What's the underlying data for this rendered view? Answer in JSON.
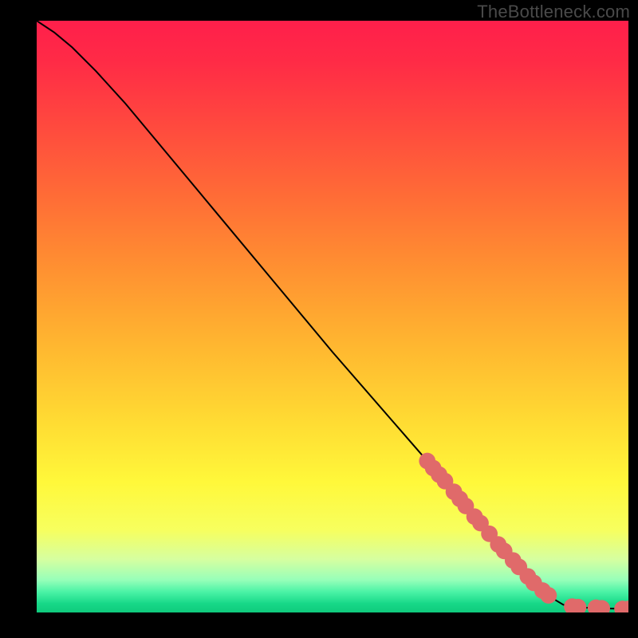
{
  "watermark": "TheBottleneck.com",
  "chart_data": {
    "type": "line",
    "title": "",
    "xlabel": "",
    "ylabel": "",
    "xlim": [
      0,
      100
    ],
    "ylim": [
      0,
      100
    ],
    "background_gradient": {
      "stops": [
        {
          "offset": 0.0,
          "color": "#ff1f4b"
        },
        {
          "offset": 0.07,
          "color": "#ff2b46"
        },
        {
          "offset": 0.18,
          "color": "#ff4a3e"
        },
        {
          "offset": 0.3,
          "color": "#ff6d36"
        },
        {
          "offset": 0.42,
          "color": "#ff9131"
        },
        {
          "offset": 0.55,
          "color": "#ffb730"
        },
        {
          "offset": 0.68,
          "color": "#ffdc33"
        },
        {
          "offset": 0.78,
          "color": "#fff83a"
        },
        {
          "offset": 0.86,
          "color": "#f7ff5e"
        },
        {
          "offset": 0.91,
          "color": "#d6ffa0"
        },
        {
          "offset": 0.945,
          "color": "#97ffb9"
        },
        {
          "offset": 0.965,
          "color": "#4bf3a6"
        },
        {
          "offset": 0.985,
          "color": "#17d888"
        },
        {
          "offset": 1.0,
          "color": "#0fca7d"
        }
      ]
    },
    "curve": {
      "comment": "line starts top-left, curved initial segment, then near-linear descent, then levels off near baseline",
      "points": [
        {
          "x": 0,
          "y": 100
        },
        {
          "x": 3,
          "y": 98
        },
        {
          "x": 6,
          "y": 95.5
        },
        {
          "x": 10,
          "y": 91.5
        },
        {
          "x": 15,
          "y": 86
        },
        {
          "x": 20,
          "y": 80
        },
        {
          "x": 30,
          "y": 68
        },
        {
          "x": 40,
          "y": 56
        },
        {
          "x": 50,
          "y": 44
        },
        {
          "x": 60,
          "y": 32.5
        },
        {
          "x": 70,
          "y": 21
        },
        {
          "x": 78,
          "y": 11.5
        },
        {
          "x": 84,
          "y": 5
        },
        {
          "x": 87,
          "y": 2.5
        },
        {
          "x": 89,
          "y": 1.3
        },
        {
          "x": 91,
          "y": 0.9
        },
        {
          "x": 95,
          "y": 0.7
        },
        {
          "x": 100,
          "y": 0.6
        }
      ]
    },
    "marker_color": "#e06a6a",
    "marker_radius_pct": 1.4,
    "markers": [
      {
        "x": 66.0,
        "y": 25.6
      },
      {
        "x": 67.0,
        "y": 24.4
      },
      {
        "x": 68.0,
        "y": 23.3
      },
      {
        "x": 69.0,
        "y": 22.2
      },
      {
        "x": 70.5,
        "y": 20.4
      },
      {
        "x": 71.5,
        "y": 19.2
      },
      {
        "x": 72.5,
        "y": 18.0
      },
      {
        "x": 74.0,
        "y": 16.2
      },
      {
        "x": 75.0,
        "y": 15.1
      },
      {
        "x": 76.5,
        "y": 13.3
      },
      {
        "x": 78.0,
        "y": 11.5
      },
      {
        "x": 79.0,
        "y": 10.4
      },
      {
        "x": 80.5,
        "y": 8.8
      },
      {
        "x": 81.5,
        "y": 7.7
      },
      {
        "x": 83.0,
        "y": 6.1
      },
      {
        "x": 84.0,
        "y": 5.0
      },
      {
        "x": 85.5,
        "y": 3.7
      },
      {
        "x": 86.5,
        "y": 2.9
      },
      {
        "x": 90.5,
        "y": 1.0
      },
      {
        "x": 91.5,
        "y": 0.9
      },
      {
        "x": 94.5,
        "y": 0.8
      },
      {
        "x": 95.5,
        "y": 0.7
      },
      {
        "x": 99.0,
        "y": 0.6
      },
      {
        "x": 100.0,
        "y": 0.6
      }
    ]
  }
}
